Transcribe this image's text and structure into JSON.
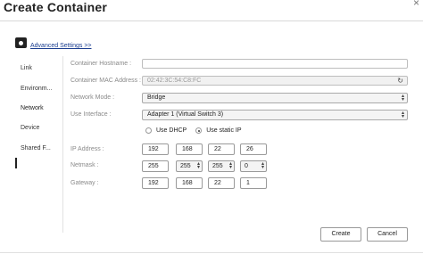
{
  "dialog": {
    "title": "Create Container",
    "close_glyph": "×"
  },
  "advanced": {
    "label": "Advanced Settings >>",
    "icon": "gear-icon"
  },
  "sidebar": {
    "items": [
      {
        "label": "Link"
      },
      {
        "label": "Environm..."
      },
      {
        "label": "Network",
        "active": true
      },
      {
        "label": "Device"
      },
      {
        "label": "Shared F..."
      }
    ]
  },
  "form": {
    "hostname": {
      "label": "Container Hostname :",
      "value": ""
    },
    "mac": {
      "label": "Container MAC Address :",
      "placeholder": "02:42:3C:54:C8:FC",
      "icon": "refresh-icon"
    },
    "network_mode": {
      "label": "Network Mode :",
      "value": "Bridge"
    },
    "use_interface": {
      "label": "Use Interface :",
      "value": "Adapter 1 (Virtual Switch 3)"
    },
    "ip_mode": {
      "dhcp_label": "Use DHCP",
      "static_label": "Use static IP",
      "selected": "static"
    },
    "ip_address": {
      "label": "IP Address :",
      "octets": [
        "192",
        "168",
        "22",
        "26"
      ]
    },
    "netmask": {
      "label": "Netmask :",
      "octets": [
        "255",
        "255",
        "255",
        "0"
      ]
    },
    "gateway": {
      "label": "Gateway :",
      "octets": [
        "192",
        "168",
        "22",
        "1"
      ]
    }
  },
  "buttons": {
    "create": "Create",
    "cancel": "Cancel"
  }
}
